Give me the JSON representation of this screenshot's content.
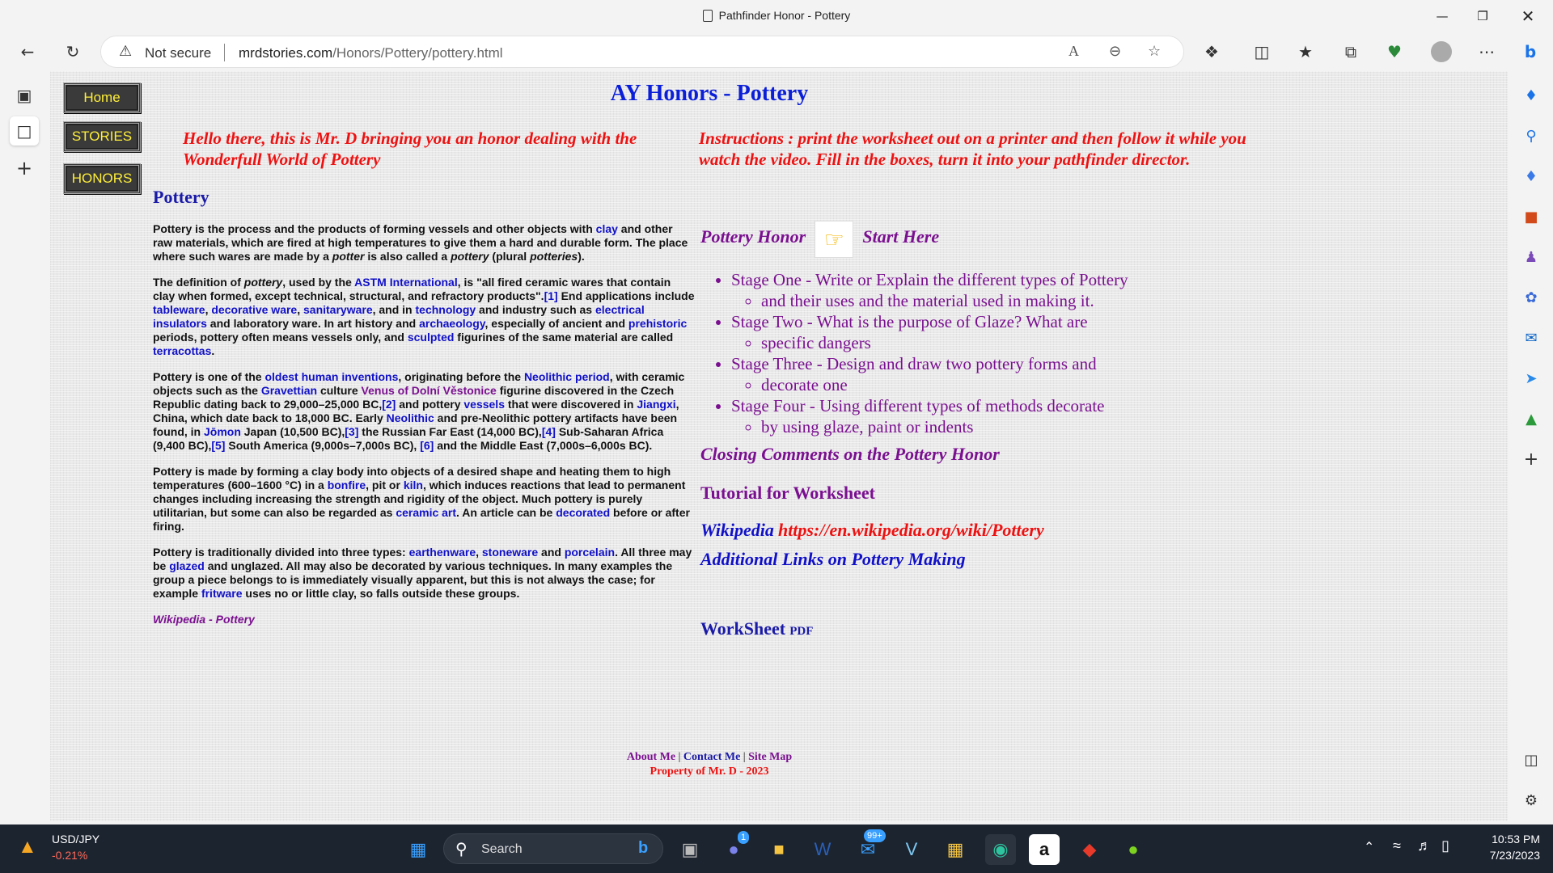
{
  "window": {
    "title": "Pathfinder Honor - Pottery"
  },
  "toolbar": {
    "security_label": "Not secure",
    "url_host": "mrdstories.com",
    "url_path": "/Honors/Pottery/pottery.html"
  },
  "page": {
    "title": "AY Honors - Pottery",
    "nav": [
      {
        "label": "Home"
      },
      {
        "label": "STORIES"
      },
      {
        "label": "HONORS"
      }
    ],
    "intro_left": "Hello there, this is Mr. D bringing you an honor dealing with the Wonderfull World of Pottery",
    "intro_right": "Instructions : print the worksheet out on a printer and then follow it while you watch the video. Fill in the boxes, turn it into your pathfinder director.",
    "left": {
      "heading": "Pottery",
      "p1": {
        "a": "Pottery is the process and the products of forming vessels and other objects with ",
        "clay": "clay",
        "b": " and other raw materials, which are fired at high temperatures to give them a hard and durable form. The place where such wares are made by a ",
        "potter": "potter",
        "c": " is also called a ",
        "pottery": "pottery",
        "d": " (plural ",
        "potteries": "potteries",
        "e": ")."
      },
      "p2": {
        "a": "The definition of ",
        "pottery": "pottery",
        "b": ", used by the ",
        "astm": "ASTM International",
        "c": ", is \"all fired ceramic wares that contain clay when formed, except technical, structural, and refractory products\".",
        "ref1": "[1]",
        "d": " End applications include ",
        "tableware": "tableware",
        "e": ", ",
        "decorative": "decorative ware",
        "f": ", ",
        "sanitary": "sanitaryware",
        "g": ", and in ",
        "technology": "technology",
        "h": " and industry such as ",
        "insulators": "electrical insulators",
        "i": " and laboratory ware. In art history and ",
        "archaeology": "archaeology",
        "j": ", especially of ancient and ",
        "prehistoric": "prehistoric",
        "k": " periods, pottery often means vessels only, and ",
        "sculpted": "sculpted",
        "l": " figurines of the same material are called ",
        "terracottas": "terracottas",
        "m": "."
      },
      "p3": {
        "a": "Pottery is one of the ",
        "oldest": "oldest human inventions",
        "b": ", originating before the ",
        "neolithic": "Neolithic period",
        "c": ", with ceramic objects such as the ",
        "gravettian": "Gravettian",
        "d": " culture ",
        "venus": "Venus of Dolní Věstonice",
        "e": " figurine discovered in the Czech Republic dating back to 29,000–25,000 BC,",
        "ref2": "[2]",
        "f": " and pottery ",
        "vessels": "vessels",
        "g": " that were discovered in ",
        "jiangxi": "Jiangxi",
        "h": ", China, which date back to 18,000 BC. Early ",
        "neolithic2": "Neolithic",
        "i": " and pre-Neolithic pottery artifacts have been found, in ",
        "jomon": "Jōmon",
        "j": " Japan (10,500 BC),",
        "ref3": "[3]",
        "k": " the Russian Far East (14,000 BC),",
        "ref4": "[4]",
        "l": " Sub-Saharan Africa (9,400 BC),",
        "ref5": "[5]",
        "m": " South America (9,000s–7,000s BC),",
        "ref6": "[6]",
        "n": " and the Middle East (7,000s–6,000s BC)."
      },
      "p4": {
        "a": "Pottery is made by forming a clay body into objects of a desired shape and heating them to high temperatures (600–1600 °C) in a ",
        "bonfire": "bonfire",
        "b": ", pit or ",
        "kiln": "kiln",
        "c": ", which induces reactions that lead to permanent changes including increasing the strength and rigidity of the object. Much pottery is purely utilitarian, but some can also be regarded as ",
        "ceramic_art": "ceramic art",
        "d": ". An article can be ",
        "decorated": "decorated",
        "e": " before or after firing."
      },
      "p5": {
        "a": "Pottery is traditionally divided into three types: ",
        "earthenware": "earthenware",
        "b": ", ",
        "stoneware": "stoneware",
        "c": " and ",
        "porcelain": "porcelain",
        "d": ". All three may be ",
        "glazed": "glazed",
        "e": " and unglazed. All may also be decorated by various techniques. In many examples the group a piece belongs to is immediately visually apparent, but this is not always the case; for example ",
        "fritware": "fritware",
        "f": " uses no or little clay, so falls outside these groups."
      },
      "source": "Wikipedia - Pottery"
    },
    "right": {
      "honor_label": "Pottery Honor",
      "start_label": "Start Here",
      "stages": [
        {
          "main": "Stage One - Write or Explain the different types of Pottery",
          "sub": "and their uses and the material used in making it."
        },
        {
          "main": "Stage Two - What is the purpose of Glaze? What are",
          "sub": "specific dangers"
        },
        {
          "main": "Stage Three - Design and draw two pottery forms and",
          "sub": "decorate one"
        },
        {
          "main": "Stage Four - Using different types of methods decorate",
          "sub": "by using glaze, paint or indents"
        }
      ],
      "closing": "Closing Comments on the Pottery Honor",
      "tutorial": "Tutorial for Worksheet",
      "wiki_label": "Wikipedia",
      "wiki_url": "https://en.wikipedia.org/wiki/Pottery",
      "additional": "Additional Links on Pottery Making",
      "worksheet": "WorkSheet",
      "pdf": "PDF"
    },
    "footer": {
      "about": "About Me",
      "sep": "|",
      "contact": "Contact Me",
      "sitemap": "Site Map",
      "property": "Property of Mr. D - 2023"
    }
  },
  "taskbar": {
    "ticker_symbol": "USD/JPY",
    "ticker_change": "-0.21%",
    "search_placeholder": "Search",
    "teams_badge": "1",
    "mail_badge": "99+",
    "time": "10:53 PM",
    "date": "7/23/2023"
  },
  "colors": {
    "title_blue": "#0b1fd8",
    "intro_red": "#ee1111",
    "honor_purple": "#7a1090",
    "nav_yellow": "#ffef3a"
  }
}
